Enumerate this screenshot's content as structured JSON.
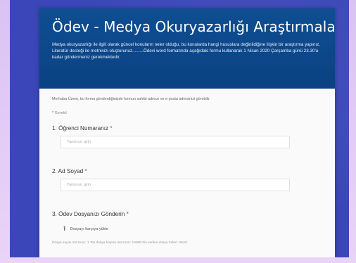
{
  "form": {
    "title": "Ödev - Medya Okuryazarlığı Araştırmaları",
    "description": "Medya okuryazarlığı ile ilgili olarak güncel konuların neler olduğu, bu konularda hangi hususlara değinildiğine ilişkin bir araştırma yapınız. Literatür desteği ile metninizi oluşturunuz.........Ödevi word formatında aşağıdaki formu kullanarak 1 Nisan 2020 Çarşamba günü 23.30'a kadar göndermeniz gerekmektedir.",
    "intro": "Merhaba Üzem, bu formu gönderdiğinizde formun sahibi adınızı ve e-posta adresinizi görebilir.",
    "required_marker": "*",
    "required_label": "Gerekli"
  },
  "questions": [
    {
      "label": "1. Öğrenci Numaranız",
      "star": "*",
      "placeholder": "Yanıtınızı girin"
    },
    {
      "label": "2. Ad Soyad",
      "star": "*",
      "placeholder": "Yanıtınızı girin"
    },
    {
      "label": "3. Ödev Dosyanızı Gönderin",
      "star": "*"
    }
  ],
  "upload": {
    "icon": "upload-icon",
    "label": "Dosyayı karşıya yükle",
    "hint": "Dosya sayısı üst sınırı: 1   Tek dosya boyutu üst sınırı: 10MB   İzin verilen dosya türleri: Word"
  },
  "colors": {
    "background": "#3b47b8",
    "header": "#0f4e92",
    "required_star": "#c43b3b"
  }
}
